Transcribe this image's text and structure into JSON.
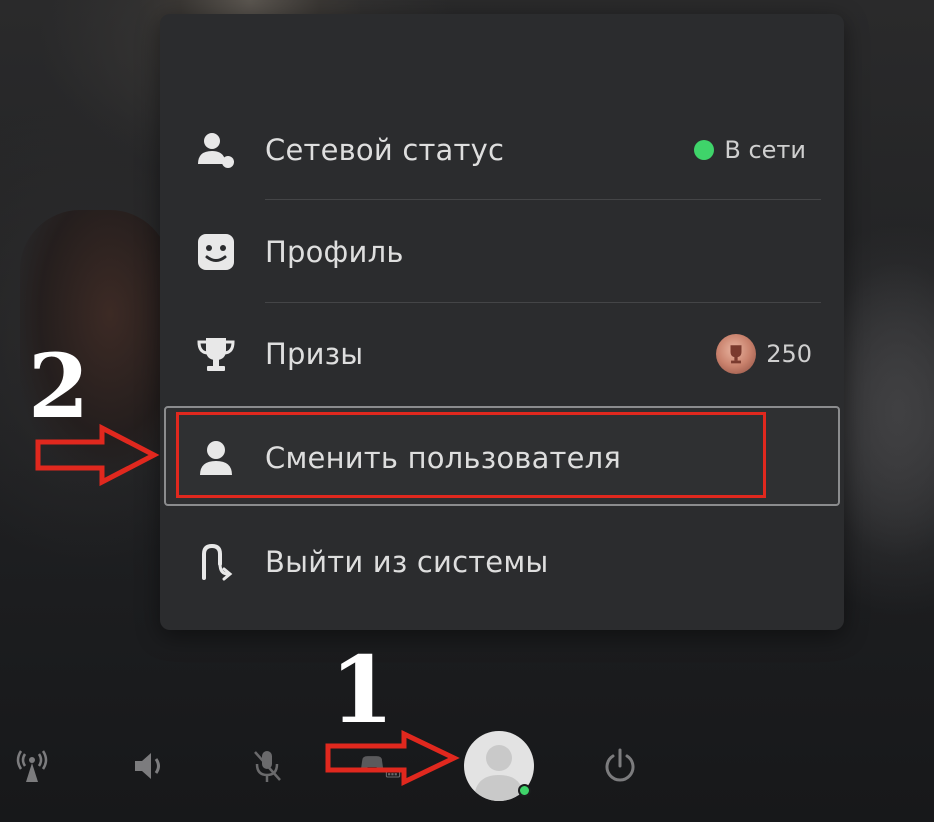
{
  "menu": {
    "items": [
      {
        "id": "network-status",
        "label": "Сетевой статус",
        "status_text": "В сети",
        "status_color": "#3fd46a",
        "icon": "person-status-icon"
      },
      {
        "id": "profile",
        "label": "Профиль",
        "icon": "smiley-icon"
      },
      {
        "id": "trophies",
        "label": "Призы",
        "trophy_count": "250",
        "icon": "trophy-icon"
      },
      {
        "id": "switch-user",
        "label": "Сменить пользователя",
        "icon": "person-icon",
        "selected": true
      },
      {
        "id": "log-out",
        "label": "Выйти из системы",
        "icon": "logout-icon"
      }
    ]
  },
  "bottom_bar": {
    "icons": [
      "remote-play-icon",
      "volume-icon",
      "mic-muted-icon",
      "controller-battery-icon",
      "user-avatar",
      "power-icon"
    ],
    "avatar_status_color": "#3fd46a"
  },
  "annotations": {
    "step1": "1",
    "step2": "2",
    "highlight_color": "#e0281e"
  }
}
